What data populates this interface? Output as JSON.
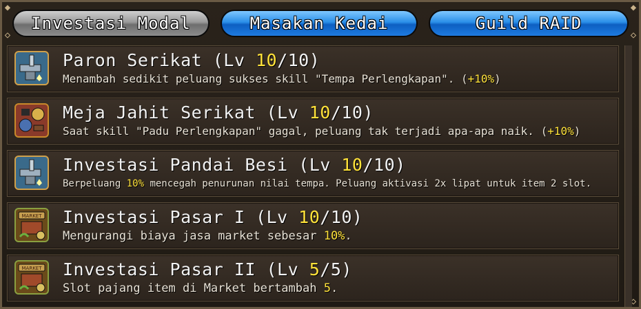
{
  "tabs": [
    {
      "label": "Investasi Modal",
      "state": "inactive"
    },
    {
      "label": "Masakan Kedai",
      "state": "active"
    },
    {
      "label": "Guild RAID",
      "state": "active"
    }
  ],
  "items": [
    {
      "icon": "anvil-icon",
      "name": "Paron Serikat",
      "lv_prefix": "(Lv ",
      "lv_current": "10",
      "lv_max": "/10)",
      "desc_pre": "Menambah sedikit peluang sukses skill \"Tempa Perlengkapan\". (",
      "desc_hl": "+10%",
      "desc_post": ")"
    },
    {
      "icon": "sewing-table-icon",
      "name": "Meja Jahit Serikat",
      "lv_prefix": "(Lv ",
      "lv_current": "10",
      "lv_max": "/10)",
      "desc_pre": "Saat skill \"Padu Perlengkapan\" gagal, peluang tak terjadi apa-apa naik. (",
      "desc_hl": "+10%",
      "desc_post": ")"
    },
    {
      "icon": "anvil-icon",
      "name": "Investasi Pandai Besi",
      "lv_prefix": "(Lv ",
      "lv_current": "10",
      "lv_max": "/10)",
      "desc_pre": "Berpeluang ",
      "desc_hl": "10%",
      "desc_post": " mencegah penurunan nilai tempa. Peluang aktivasi 2x lipat untuk item 2 slot."
    },
    {
      "icon": "market-chest-icon",
      "name": "Investasi Pasar I",
      "lv_prefix": "(Lv ",
      "lv_current": "10",
      "lv_max": "/10)",
      "desc_pre": "Mengurangi biaya jasa market sebesar ",
      "desc_hl": "10%",
      "desc_post": "."
    },
    {
      "icon": "market-chest-icon",
      "name": "Investasi Pasar II",
      "lv_prefix": "(Lv ",
      "lv_current": "5",
      "lv_max": "/5)",
      "desc_pre": "Slot pajang item di Market bertambah ",
      "desc_hl": "5",
      "desc_post": "."
    }
  ],
  "market_sign": "MARKET",
  "colors": {
    "highlight": "#ffe23a",
    "active_tab": "#1e7be0",
    "inactive_tab": "#9a9a9a"
  }
}
